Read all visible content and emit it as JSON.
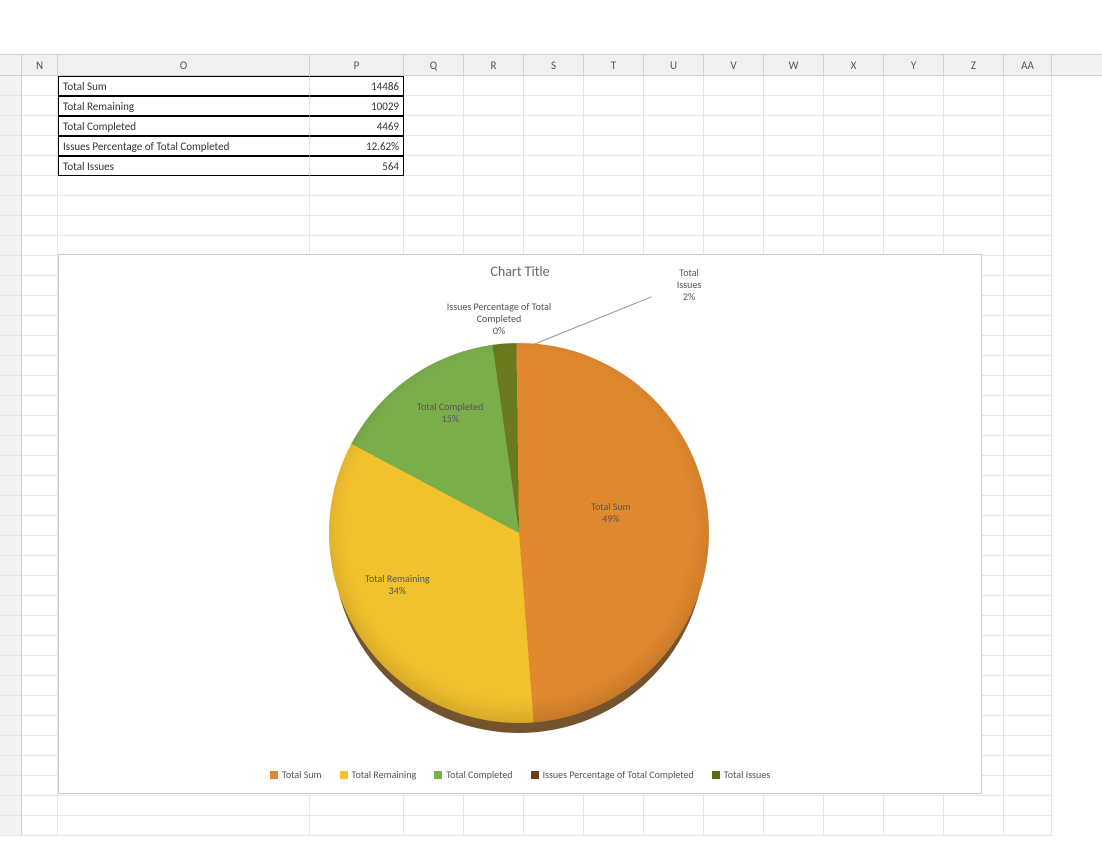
{
  "columns": [
    "N",
    "O",
    "P",
    "Q",
    "R",
    "S",
    "T",
    "U",
    "V",
    "W",
    "X",
    "Y",
    "Z",
    "AA"
  ],
  "table": {
    "rows": [
      {
        "label": "Total Sum",
        "value": "14486"
      },
      {
        "label": "Total Remaining",
        "value": "10029"
      },
      {
        "label": "Total Completed",
        "value": "4469"
      },
      {
        "label": "Issues Percentage of Total Completed",
        "value": "12.62%"
      },
      {
        "label": "Total Issues",
        "value": "564"
      }
    ]
  },
  "chart": {
    "title": "Chart Title",
    "labels": {
      "total_sum": {
        "name": "Total Sum",
        "pct": "49%"
      },
      "total_remaining": {
        "name": "Total Remaining",
        "pct": "34%"
      },
      "total_completed": {
        "name": "Total Completed",
        "pct": "15%"
      },
      "issues_pct": {
        "name": "Issues Percentage of Total",
        "name2": "Completed",
        "pct": "0%"
      },
      "total_issues": {
        "name": "Total",
        "name2": "Issues",
        "pct": "2%"
      }
    },
    "legend": [
      {
        "label": "Total Sum",
        "color": "#e0892f"
      },
      {
        "label": "Total Remaining",
        "color": "#f2c12e"
      },
      {
        "label": "Total Completed",
        "color": "#7aae4a"
      },
      {
        "label": "Issues Percentage of Total Completed",
        "color": "#6b3f17"
      },
      {
        "label": "Total Issues",
        "color": "#5a6b1a"
      }
    ]
  },
  "chart_data": {
    "type": "pie",
    "title": "Chart Title",
    "series": [
      {
        "name": "Total Sum",
        "value": 14486,
        "percent": 49,
        "color": "#e0892f"
      },
      {
        "name": "Total Remaining",
        "value": 10029,
        "percent": 34,
        "color": "#f2c12e"
      },
      {
        "name": "Total Completed",
        "value": 4469,
        "percent": 15,
        "color": "#7aae4a"
      },
      {
        "name": "Issues Percentage of Total Completed",
        "value": 12.62,
        "percent": 0,
        "color": "#6b3f17"
      },
      {
        "name": "Total Issues",
        "value": 564,
        "percent": 2,
        "color": "#5a6b1a"
      }
    ]
  }
}
